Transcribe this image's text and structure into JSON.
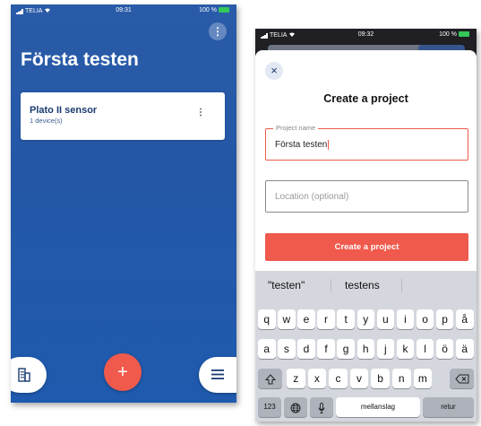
{
  "left_screen": {
    "status": {
      "carrier": "TELIA",
      "time": "09:31",
      "battery": "100 %"
    },
    "project_title": "Första testen",
    "sensor_card": {
      "name": "Plato II sensor",
      "device_count": "1 device(s)"
    },
    "add_label": "+"
  },
  "right_screen": {
    "status": {
      "carrier": "TELIA",
      "time": "09:32",
      "battery": "100 %"
    },
    "dialog": {
      "title": "Create a project",
      "close_label": "×",
      "project_name_label": "Project name",
      "project_name_value": "Första testen",
      "location_placeholder": "Location (optional)",
      "submit_label": "Create a project"
    },
    "keyboard": {
      "suggestions": [
        "\"testen\"",
        "testens"
      ],
      "row1": [
        "q",
        "w",
        "e",
        "r",
        "t",
        "y",
        "u",
        "i",
        "o",
        "p",
        "å"
      ],
      "row2": [
        "a",
        "s",
        "d",
        "f",
        "g",
        "h",
        "j",
        "k",
        "l",
        "ö",
        "ä"
      ],
      "row3": [
        "z",
        "x",
        "c",
        "v",
        "b",
        "n",
        "m"
      ],
      "numbers_label": "123",
      "space_label": "mellanslag",
      "return_label": "retur"
    }
  },
  "colors": {
    "brand_blue": "#2458a6",
    "accent_red": "#f05a4c"
  },
  "icons": [
    "wifi-icon",
    "more-vertical-icon",
    "building-icon",
    "plus-icon",
    "menu-icon",
    "close-icon",
    "shift-icon",
    "backspace-icon",
    "globe-icon",
    "microphone-icon"
  ]
}
